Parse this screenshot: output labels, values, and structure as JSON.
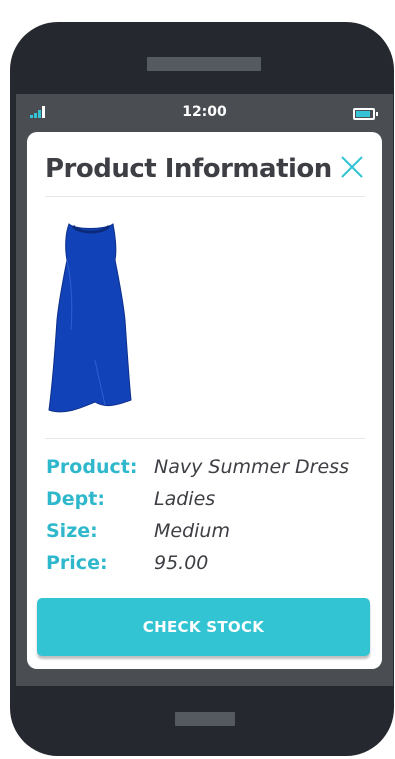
{
  "status_bar": {
    "time": "12:00",
    "signal_icon": "signal-bars-icon",
    "battery_icon": "battery-icon"
  },
  "modal": {
    "title": "Product Information",
    "close_icon": "close-icon",
    "product_image": "dress-image",
    "details": [
      {
        "label": "Product:",
        "value": "Navy Summer Dress"
      },
      {
        "label": "Dept:",
        "value": "Ladies"
      },
      {
        "label": "Size:",
        "value": "Medium"
      },
      {
        "label": "Price:",
        "value": "95.00"
      }
    ],
    "action_button": "CHECK STOCK"
  },
  "colors": {
    "accent": "#33c4d4",
    "title_text": "#3d3f44",
    "dress": "#1242b8",
    "phone_body": "#25282e"
  }
}
